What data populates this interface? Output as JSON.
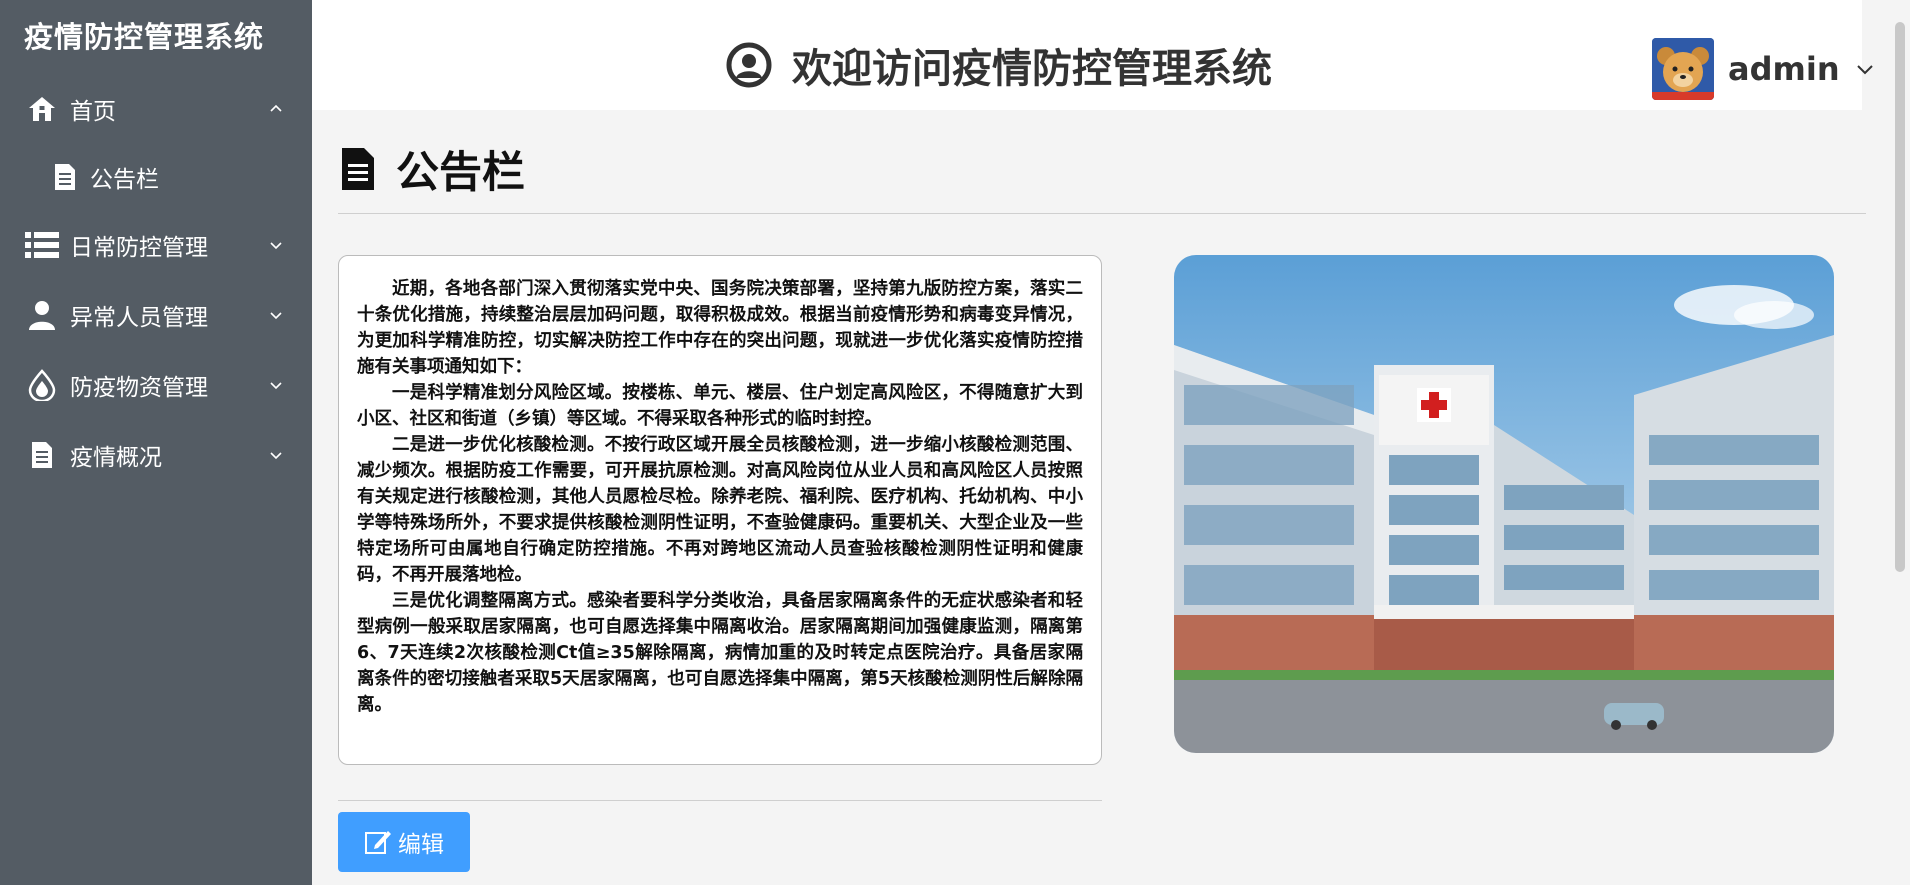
{
  "sidebar": {
    "brand": "疫情防控管理系统",
    "items": [
      {
        "label": "首页",
        "icon": "home-icon"
      },
      {
        "label": "日常防控管理",
        "icon": "list-icon"
      },
      {
        "label": "异常人员管理",
        "icon": "user-icon"
      },
      {
        "label": "防疫物资管理",
        "icon": "drop-icon"
      },
      {
        "label": "疫情概况",
        "icon": "document-icon"
      }
    ],
    "subitems": [
      {
        "label": "公告栏",
        "icon": "document-icon"
      }
    ]
  },
  "header": {
    "title": "欢迎访问疫情防控管理系统",
    "username": "admin"
  },
  "main": {
    "page_title": "公告栏",
    "notice_paragraphs": [
      "近期，各地各部门深入贯彻落实党中央、国务院决策部署，坚持第九版防控方案，落实二十条优化措施，持续整治层层加码问题，取得积极成效。根据当前疫情形势和病毒变异情况，为更加科学精准防控，切实解决防控工作中存在的突出问题，现就进一步优化落实疫情防控措施有关事项通知如下：",
      "一是科学精准划分风险区域。按楼栋、单元、楼层、住户划定高风险区，不得随意扩大到小区、社区和街道（乡镇）等区域。不得采取各种形式的临时封控。",
      "二是进一步优化核酸检测。不按行政区域开展全员核酸检测，进一步缩小核酸检测范围、减少频次。根据防疫工作需要，可开展抗原检测。对高风险岗位从业人员和高风险区人员按照有关规定进行核酸检测，其他人员愿检尽检。除养老院、福利院、医疗机构、托幼机构、中小学等特殊场所外，不要求提供核酸检测阴性证明，不查验健康码。重要机关、大型企业及一些特定场所可由属地自行确定防控措施。不再对跨地区流动人员查验核酸检测阴性证明和健康码，不再开展落地检。",
      "三是优化调整隔离方式。感染者要科学分类收治，具备居家隔离条件的无症状感染者和轻型病例一般采取居家隔离，也可自愿选择集中隔离收治。居家隔离期间加强健康监测，隔离第6、7天连续2次核酸检测Ct值≥35解除隔离，病情加重的及时转定点医院治疗。具备居家隔离条件的密切接触者采取5天居家隔离，也可自愿选择集中隔离，第5天核酸检测阴性后解除隔离。"
    ],
    "edit_label": "编辑"
  },
  "colors": {
    "sidebar_bg": "#545c64",
    "accent": "#409eff",
    "page_bg": "#f4f4f4"
  }
}
